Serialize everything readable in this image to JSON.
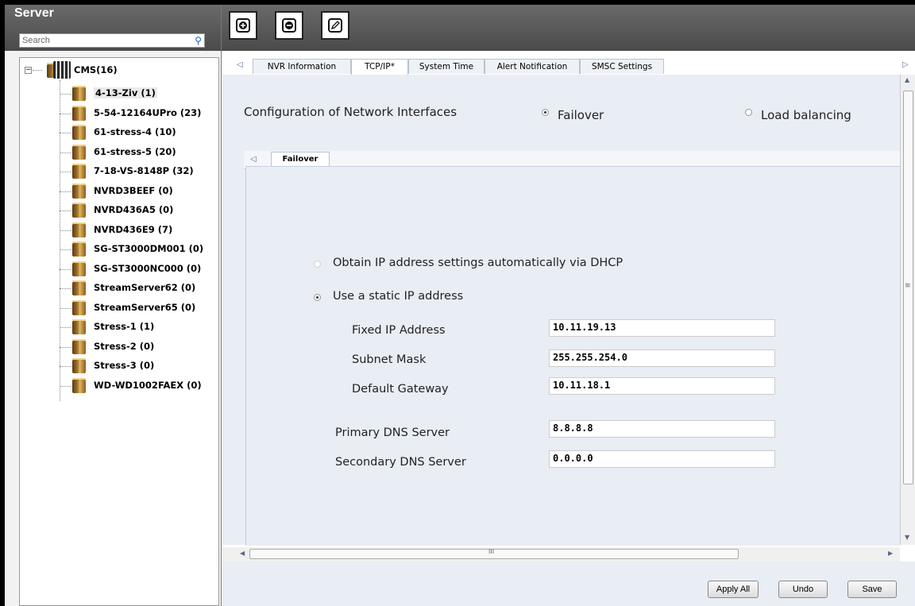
{
  "panel": {
    "title": "Server",
    "search_placeholder": "Search"
  },
  "tree": {
    "root": "CMS(16)",
    "items": [
      "4-13-Ziv (1)",
      "5-54-12164UPro (23)",
      "61-stress-4 (10)",
      "61-stress-5 (20)",
      "7-18-VS-8148P (32)",
      "NVRD3BEEF (0)",
      "NVRD436A5 (0)",
      "NVRD436E9 (7)",
      "SG-ST3000DM001 (0)",
      "SG-ST3000NC000 (0)",
      "StreamServer62 (0)",
      "StreamServer65 (0)",
      "Stress-1 (1)",
      "Stress-2 (0)",
      "Stress-3 (0)",
      "WD-WD1002FAEX (0)"
    ]
  },
  "toolbar": {
    "icons": [
      "add-icon",
      "remove-icon",
      "edit-icon"
    ]
  },
  "tabs": [
    "NVR Information",
    "TCP/IP*",
    "System Time",
    "Alert Notification",
    "SMSC Settings"
  ],
  "config": {
    "label": "Configuration of Network Interfaces",
    "failover": "Failover",
    "load_balancing": "Load balancing"
  },
  "subtab": "Failover",
  "ip": {
    "dhcp_label": "Obtain IP address settings automatically via DHCP",
    "static_label": "Use a static IP address",
    "fixed_label": "Fixed IP Address",
    "fixed_value": "10.11.19.13",
    "subnet_label": "Subnet Mask",
    "subnet_value": "255.255.254.0",
    "gateway_label": "Default Gateway",
    "gateway_value": "10.11.18.1",
    "dns1_label": "Primary DNS Server",
    "dns1_value": "8.8.8.8",
    "dns2_label": "Secondary DNS Server",
    "dns2_value": "0.0.0.0"
  },
  "buttons": {
    "apply_all": "Apply All",
    "undo": "Undo",
    "save": "Save"
  },
  "scroll": {
    "h_grip": "III",
    "v_grip": "≡"
  }
}
